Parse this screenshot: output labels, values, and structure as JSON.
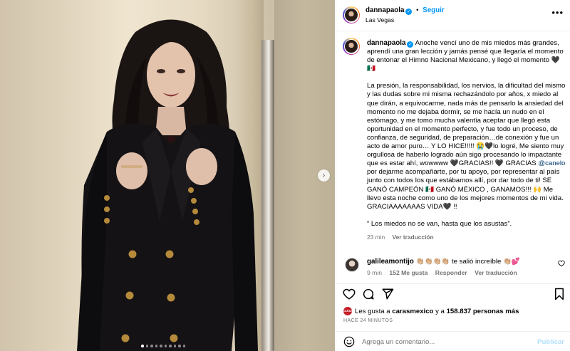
{
  "post": {
    "username": "dannapaola",
    "follow_label": "Seguir",
    "location": "Las Vegas",
    "more_label": "•••"
  },
  "caption": {
    "username": "dannapaola",
    "para1": "Anoche vencí uno de mis miedos más grandes, aprendí una gran lección y jamás pensé que llegaría el momento de entonar el Himno Nacional Mexicano, y llegó el momento 🖤🇲🇽",
    "para2_a": "La presión, la responsabilidad, los nervios, la dificultad del mismo y las dudas sobre mi misma rechazándolo por años, x miedo al que dirán, a equivocarme, nada más de pensarlo la ansiedad del momento no me dejaba dormir, se me hacía un nudo en el estómago, y me tomo mucha valentía aceptar que llegó esta oportunidad en el momento perfecto, y fue todo un proceso, de confianza, de seguridad, de preparación…de conexión y fue un acto de amor puro… Y LO HICE!!!!! 😭🖤lo logré, Me siento muy orgullosa de haberlo logrado aún sigo procesando lo impactante que es estar ahí, wowwww 🖤GRACIAS!! 🖤 GRACIAS ",
    "mention": "@canelo",
    "para2_b": " por dejarme acompañarte, por tu apoyo, por representar al país junto con todos los que estábamos allí, por dar todo de ti! SE GANÓ CAMPEÓN 🇲🇽 GANÓ MÉXICO , GANAMOS!!! 🙌 Me llevo esta noche como uno de los mejores momentos de mi vida. GRACIAAAAAAAS VIDA🖤 !!",
    "para3": "“ Los miedos no se van, hasta que los asustas”.",
    "time": "23 min",
    "translate": "Ver traducción"
  },
  "comment": {
    "username": "galileamontijo",
    "text": "👏🏼👏🏼👏🏼👏🏼 te salió increíble 👏🏼💕",
    "time": "9 min",
    "likes": "152 Me gusta",
    "reply": "Responder",
    "translate": "Ver traducción"
  },
  "likes": {
    "prefix": "Les gusta a ",
    "user": "carasmexico",
    "middle": " y a ",
    "count": "158.837 personas más",
    "avatar_text": "CARAS"
  },
  "posted_ago": "HACE 24 MINUTOS",
  "add_comment": {
    "placeholder": "Agrega un comentario...",
    "publish": "Publicar"
  },
  "carousel": {
    "total": 10,
    "active": 1,
    "next_icon": "chevron-right-icon"
  },
  "colors": {
    "accent": "#0095f6",
    "muted": "#737373",
    "publish_disabled": "#b2dffc"
  }
}
